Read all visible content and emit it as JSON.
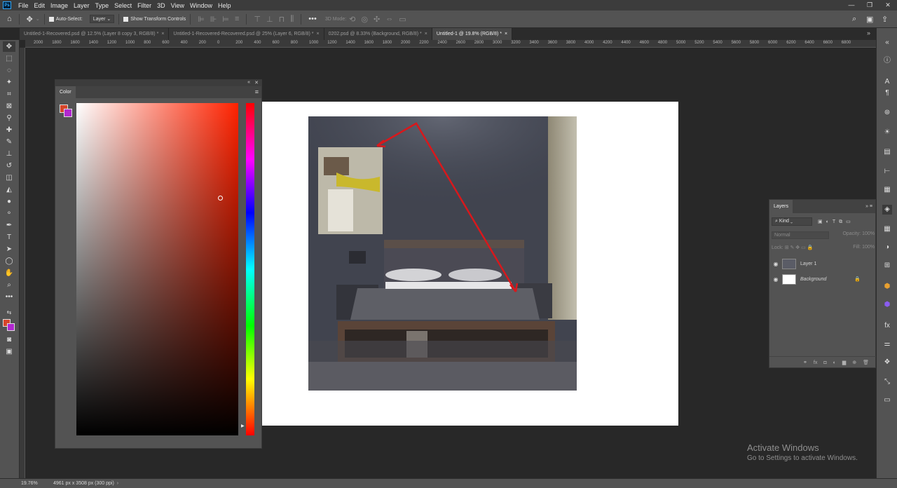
{
  "menubar": {
    "logo": "Ps",
    "items": [
      "File",
      "Edit",
      "Image",
      "Layer",
      "Type",
      "Select",
      "Filter",
      "3D",
      "View",
      "Window",
      "Help"
    ]
  },
  "options": {
    "auto_select_label": "Auto-Select:",
    "auto_select_value": "Layer",
    "show_transform_label": "Show Transform Controls",
    "mode_3d_label": "3D Mode:",
    "more": "•••"
  },
  "tabs": [
    {
      "label": "Untitled-1-Recovered.psd @ 12.5% (Layer 8 copy 3, RGB/8) *",
      "active": false
    },
    {
      "label": "Untitled-1-Recovered-Recovered.psd @ 25% (Layer 6, RGB/8) *",
      "active": false
    },
    {
      "label": "0202.psd @ 8.33% (Background, RGB/8) *",
      "active": false
    },
    {
      "label": "Untitled-1 @ 19.8% (RGB/8) *",
      "active": true
    }
  ],
  "ruler": {
    "labels": [
      "2000",
      "1800",
      "1600",
      "1400",
      "1200",
      "1000",
      "800",
      "600",
      "400",
      "200",
      "0",
      "200",
      "400",
      "600",
      "800",
      "1000",
      "1200",
      "1400",
      "1600",
      "1800",
      "2000",
      "2200",
      "2400",
      "2600",
      "2800",
      "3000",
      "3200",
      "3400",
      "3600",
      "3800",
      "4000",
      "4200",
      "4400",
      "4600",
      "4800",
      "5000",
      "5200",
      "5400",
      "5600",
      "5800",
      "6000",
      "6200",
      "6400",
      "6600",
      "6800"
    ]
  },
  "color_panel": {
    "title": "Color",
    "foreground": "#d8452a",
    "background": "#b128d0"
  },
  "layers_panel": {
    "title": "Layers",
    "kind_label": "Kind",
    "blend_mode": "Normal",
    "opacity_label": "Opacity:",
    "opacity_value": "100%",
    "lock_label": "Lock:",
    "fill_label": "Fill:",
    "fill_value": "100%",
    "layers": [
      {
        "name": "Layer 1",
        "visible": true,
        "locked": false
      },
      {
        "name": "Background",
        "visible": true,
        "locked": true
      }
    ]
  },
  "status": {
    "zoom": "19.76%",
    "doc_info": "4961 px x 3508 px (300 ppi)"
  },
  "watermark": {
    "title": "Activate Windows",
    "subtitle": "Go to Settings to activate Windows."
  }
}
